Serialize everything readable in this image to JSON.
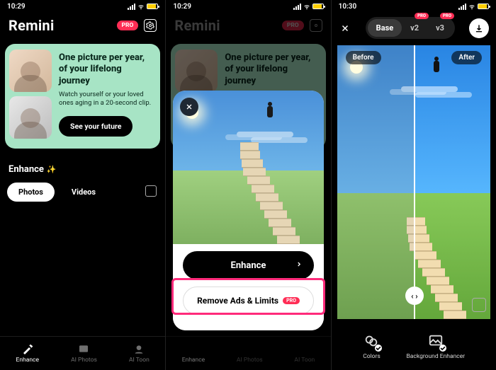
{
  "status": {
    "time_a": "10:29",
    "time_b": "10:29",
    "time_c": "10:30"
  },
  "app": {
    "name": "Remini",
    "pro_badge": "PRO"
  },
  "promo": {
    "title": "One picture per year, of your lifelong journey",
    "subtitle": "Watch yourself or your loved ones aging in a 20-second clip.",
    "cta": "See your future"
  },
  "enhance_section": {
    "label": "Enhance",
    "tabs": {
      "photos": "Photos",
      "videos": "Videos"
    }
  },
  "bottom_nav": {
    "enhance": "Enhance",
    "ai_photos": "AI Photos",
    "ai_toon": "AI Toon"
  },
  "modal": {
    "enhance_btn": "Enhance",
    "remove_btn": "Remove Ads & Limits",
    "pro_badge": "PRO"
  },
  "compare": {
    "segments": {
      "base": "Base",
      "v2": "v2",
      "v3": "v3"
    },
    "before": "Before",
    "after": "After",
    "pro_badge": "PRO"
  },
  "tools": {
    "colors": "Colors",
    "bg_enhancer": "Background Enhancer"
  }
}
